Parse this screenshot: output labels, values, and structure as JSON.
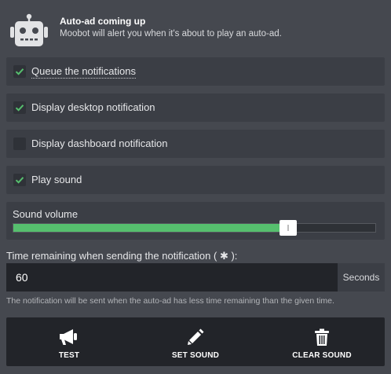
{
  "header": {
    "title": "Auto-ad coming up",
    "subtitle": "Moobot will alert you when it's about to play an auto-ad.",
    "icon": "robot-icon"
  },
  "options": [
    {
      "label": "Queue the notifications",
      "checked": true
    },
    {
      "label": "Display desktop notification",
      "checked": true
    },
    {
      "label": "Display dashboard notification",
      "checked": false
    },
    {
      "label": "Play sound",
      "checked": true
    }
  ],
  "volume": {
    "label": "Sound volume",
    "level_percent": 76
  },
  "time": {
    "label": "Time remaining when sending the notification ( ✱ ):",
    "value": "60",
    "unit": "Seconds",
    "note": "The notification will be sent when the auto-ad has less time remaining than the given time."
  },
  "actions": {
    "test_label": "TEST",
    "set_sound_label": "SET SOUND",
    "clear_sound_label": "CLEAR SOUND"
  },
  "colors": {
    "accent_green": "#56bf6e",
    "background": "#45484f",
    "panel": "#3b3e45",
    "dark": "#222429"
  }
}
